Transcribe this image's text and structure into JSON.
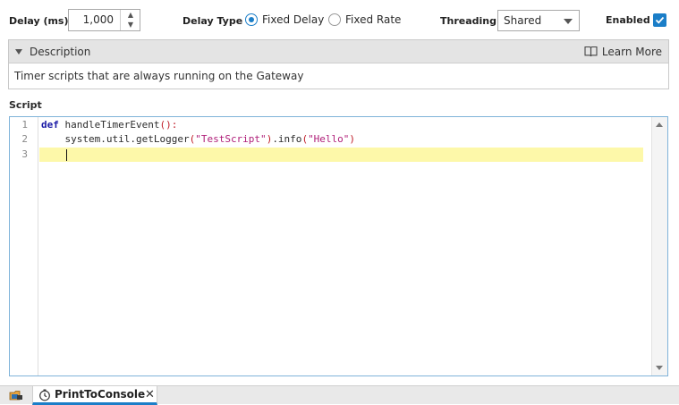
{
  "toolbar": {
    "delay_label": "Delay (ms)",
    "delay_value": "1,000",
    "delay_type_label": "Delay Type",
    "delay_type_options": [
      "Fixed Delay",
      "Fixed Rate"
    ],
    "delay_type_selected": "Fixed Delay",
    "threading_label": "Threading",
    "threading_value": "Shared",
    "enabled_label": "Enabled",
    "enabled_checked": true
  },
  "description": {
    "header": "Description",
    "learn_more": "Learn More",
    "text": "Timer scripts that are always running on the Gateway"
  },
  "script": {
    "label": "Script",
    "line_numbers": [
      "1",
      "2",
      "3"
    ],
    "lines": [
      {
        "keyword": "def",
        "rest": " handleTimerEvent",
        "paren": "():"
      },
      {
        "indent": "    ",
        "pre": "system.util.getLogger",
        "open": "(",
        "str1": "\"TestScript\"",
        "close": ")",
        "mid": ".info",
        "open2": "(",
        "str2": "\"Hello\"",
        "close2": ")"
      },
      {
        "text": ""
      }
    ],
    "current_line": 3
  },
  "bottom_tabs": {
    "active_tab": "PrintToConsole",
    "close_glyph": "✕"
  },
  "colors": {
    "accent": "#1b7ec8",
    "current_line": "#fdf8a9",
    "keyword": "#1a1aa6",
    "string": "#b0207a"
  }
}
